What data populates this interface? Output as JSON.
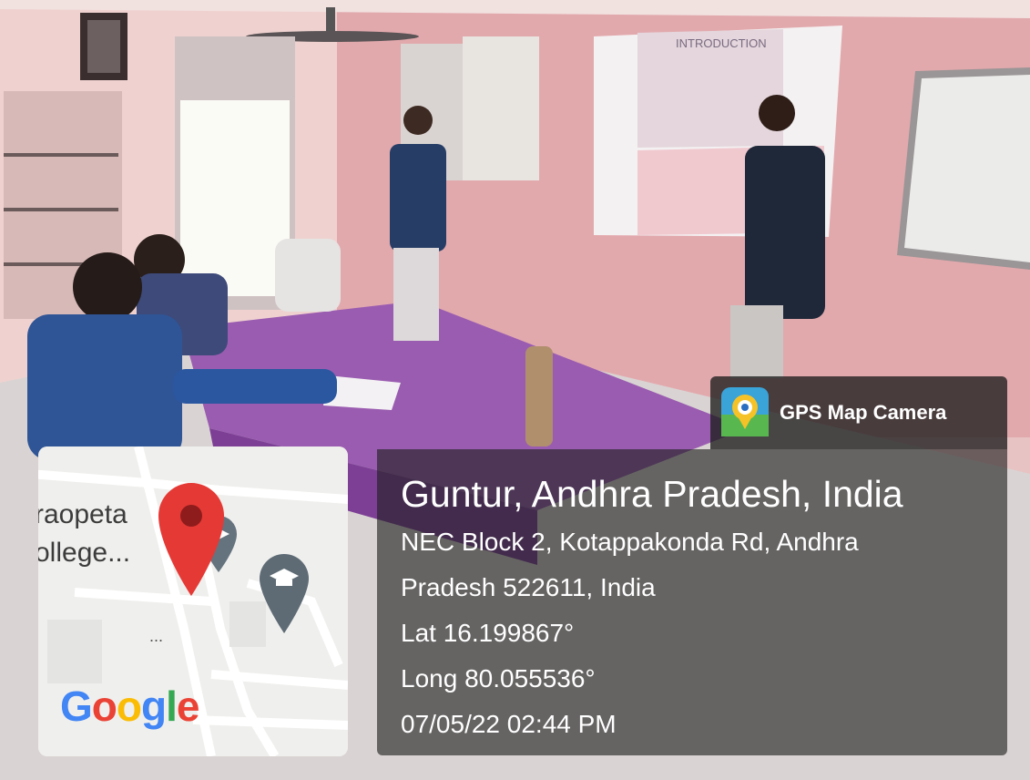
{
  "overlay": {
    "app_badge": {
      "label": "GPS Map Camera",
      "icon": "gps-map-camera-icon"
    },
    "location": {
      "title": "Guntur, Andhra Pradesh, India",
      "address_line1": "NEC Block 2, Kotappakonda Rd, Andhra",
      "address_line2": "Pradesh 522611, India",
      "latitude": "Lat 16.199867°",
      "longitude": "Long 80.055536°",
      "timestamp": "07/05/22 02:44 PM"
    },
    "map": {
      "label_line1": "raopeta",
      "label_line2": "ollege...",
      "ellipsis": "...",
      "logo": {
        "text": [
          "G",
          "o",
          "o",
          "g",
          "l",
          "e"
        ],
        "colors": [
          "#4285F4",
          "#EA4335",
          "#FBBC05",
          "#4285F4",
          "#34A853",
          "#EA4335"
        ]
      },
      "pins": [
        "location-pin-icon",
        "school-pin-icon",
        "school-pin-icon"
      ]
    }
  },
  "scene": {
    "projected_slide_title": "INTRODUCTION"
  }
}
